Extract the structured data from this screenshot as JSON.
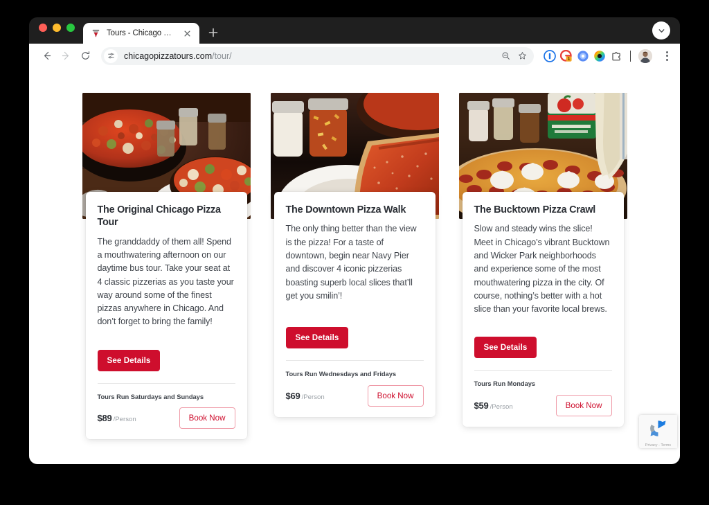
{
  "browser": {
    "traffic_lights": [
      "close",
      "minimize",
      "zoom"
    ],
    "tab": {
      "favicon": "pizza-tours-favicon",
      "title": "Tours - Chicago Pizza Tours",
      "close_label": "×"
    },
    "new_tab_label": "+",
    "window_chevron": "chevron-down-icon",
    "toolbar": {
      "back": "back-arrow-icon",
      "forward": "forward-arrow-icon",
      "reload": "reload-icon",
      "site_settings_icon": "tune-icon",
      "url_domain": "chicagopizzatours.com",
      "url_path": "/tour/",
      "zoom_out_icon": "zoom-out-icon",
      "bookmark_icon": "star-icon",
      "extensions": [
        {
          "name": "1password-extension",
          "badge": ""
        },
        {
          "name": "grammarly-extension",
          "badge": "1"
        },
        {
          "name": "loom-extension",
          "badge": ""
        },
        {
          "name": "colorful-extension",
          "badge": ""
        },
        {
          "name": "puzzle-extensions-icon",
          "badge": ""
        }
      ],
      "profile_avatar": "user-avatar",
      "menu_icon": "kebab-menu-icon"
    }
  },
  "page": {
    "cards": [
      {
        "photo_alt": "deep-dish-pizza-in-cast-iron-pan",
        "title": "The Original Chicago Pizza Tour",
        "description": "The granddaddy of them all! Spend a mouthwatering afternoon on our daytime bus tour. Take your seat at 4 classic pizzerias as you taste your way around some of the finest pizzas anywhere in Chicago. And don’t forget to bring the family!",
        "details_label": "See Details",
        "runs_label": "Tours Run Saturdays and Sundays",
        "price": "$89",
        "price_unit": "/Person",
        "book_label": "Book Now"
      },
      {
        "photo_alt": "pizza-slice-with-red-sauce-and-shakers",
        "title": "The Downtown Pizza Walk",
        "description": "The only thing better than the view is the pizza! For a taste of downtown, begin near Navy Pier and discover 4 iconic pizzerias boasting superb local slices that’ll get you smilin’!",
        "details_label": "See Details",
        "runs_label": "Tours Run Wednesdays and Fridays",
        "price": "$69",
        "price_unit": "/Person",
        "book_label": "Book Now"
      },
      {
        "photo_alt": "pepperoni-pizza-with-ricotta-being-piped",
        "title": "The Bucktown Pizza Crawl",
        "description": "Slow and steady wins the slice! Meet in Chicago’s vibrant Bucktown and Wicker Park neighborhoods and experience some of the most mouthwatering pizza in the city. Of course, nothing’s better with a hot slice than your favorite local brews.",
        "details_label": "See Details",
        "runs_label": "Tours Run Mondays",
        "price": "$59",
        "price_unit": "/Person",
        "book_label": "Book Now"
      }
    ],
    "recaptcha": {
      "icon": "recaptcha-icon",
      "legal": "Privacy - Terms"
    }
  },
  "colors": {
    "brand_red": "#ce0e2d",
    "book_border": "#ef9aa7",
    "heading": "#2b2f35",
    "body_text": "#3f444b",
    "muted": "#9aa0a6"
  }
}
